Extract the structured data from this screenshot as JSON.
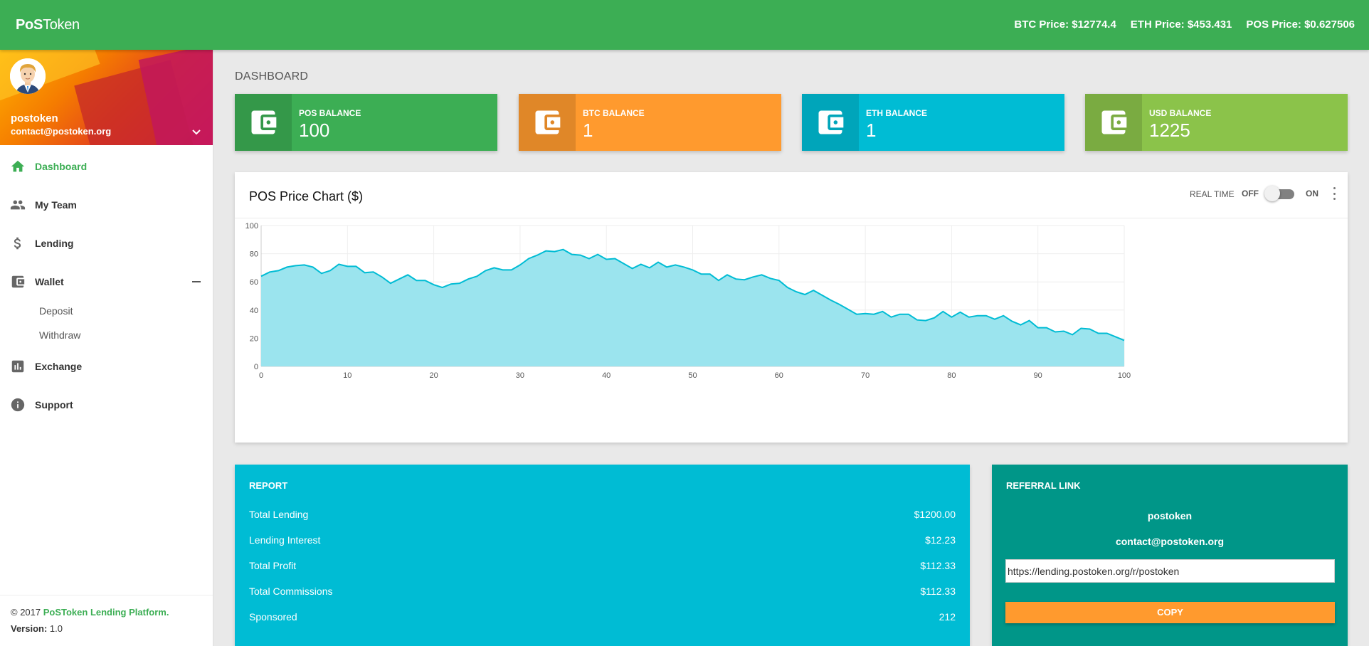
{
  "brand": {
    "part1": "PoS",
    "part2": "Token"
  },
  "prices": {
    "btc": "BTC Price: $12774.4",
    "eth": "ETH Price: $453.431",
    "pos": "POS Price: $0.627506"
  },
  "user": {
    "name": "postoken",
    "email": "contact@postoken.org"
  },
  "sidebar": {
    "items": [
      {
        "label": "Dashboard",
        "icon": "home-icon",
        "active": true
      },
      {
        "label": "My Team",
        "icon": "people-icon"
      },
      {
        "label": "Lending",
        "icon": "dollar-icon"
      },
      {
        "label": "Wallet",
        "icon": "wallet-icon"
      },
      {
        "label": "Exchange",
        "icon": "bar-chart-icon"
      },
      {
        "label": "Support",
        "icon": "info-icon"
      }
    ],
    "wallet_sub": [
      "Deposit",
      "Withdraw"
    ]
  },
  "legal": {
    "copyright_prefix": "© 2017 ",
    "company": "PoSToken Lending Platform.",
    "version_label": "Version:",
    "version": "1.0"
  },
  "page_title": "DASHBOARD",
  "balances": [
    {
      "label": "POS BALANCE",
      "value": "100",
      "color": "#3cae54"
    },
    {
      "label": "BTC BALANCE",
      "value": "1",
      "color": "#ff9a2e"
    },
    {
      "label": "ETH BALANCE",
      "value": "1",
      "color": "#00bcd4"
    },
    {
      "label": "USD BALANCE",
      "value": "1225",
      "color": "#8bc34a"
    }
  ],
  "chart_card": {
    "title": "POS Price Chart ($)",
    "realtime_label": "REAL TIME",
    "off_label": "OFF",
    "on_label": "ON"
  },
  "chart_data": {
    "type": "area",
    "title": "POS Price Chart ($)",
    "xlabel": "",
    "ylabel": "",
    "xlim": [
      0,
      100
    ],
    "ylim": [
      0,
      100
    ],
    "x_ticks": [
      0,
      10,
      20,
      30,
      40,
      50,
      60,
      70,
      80,
      90,
      100
    ],
    "y_ticks": [
      0,
      20,
      40,
      60,
      80,
      100
    ],
    "grid": true,
    "color": "#00bcd4",
    "fill": "#9be4ee",
    "series": [
      {
        "values": [
          64,
          67,
          68,
          70.5,
          71.5,
          72,
          70.5,
          66,
          68,
          72.5,
          71,
          71,
          66.5,
          67,
          63.5,
          59,
          62,
          65,
          61,
          61,
          58,
          56,
          58.5,
          59,
          62,
          64,
          68,
          70,
          68.5,
          68.5,
          72,
          76.5,
          79,
          82,
          81.5,
          83,
          79.5,
          79,
          76.5,
          79.5,
          76,
          76.5,
          73,
          69.5,
          72.5,
          70,
          74,
          70.5,
          72,
          70.5,
          68.5,
          65.5,
          65.5,
          61,
          65,
          62,
          61.5,
          63.5,
          65,
          62.5,
          61,
          56,
          53,
          51,
          54,
          50.5,
          47,
          44,
          40.5,
          37,
          37.5,
          37,
          39,
          35,
          37,
          37,
          33,
          32.5,
          34.5,
          39,
          35,
          38.5,
          35,
          36,
          36,
          33.5,
          36,
          32,
          29.5,
          32.5,
          27.5,
          27.5,
          24.5,
          25,
          22.5,
          27,
          26.5,
          23.5,
          23.5,
          21,
          18.5
        ]
      }
    ]
  },
  "report": {
    "header": "REPORT",
    "rows": [
      {
        "label": "Total Lending",
        "value": "$1200.00"
      },
      {
        "label": "Lending Interest",
        "value": "$12.23"
      },
      {
        "label": "Total Profit",
        "value": "$112.33"
      },
      {
        "label": "Total Commissions",
        "value": "$112.33"
      },
      {
        "label": "Sponsored",
        "value": "212"
      }
    ]
  },
  "referral": {
    "header": "REFERRAL LINK",
    "name": "postoken",
    "email": "contact@postoken.org",
    "link": "https://lending.postoken.org/r/postoken",
    "copy_label": "COPY"
  }
}
